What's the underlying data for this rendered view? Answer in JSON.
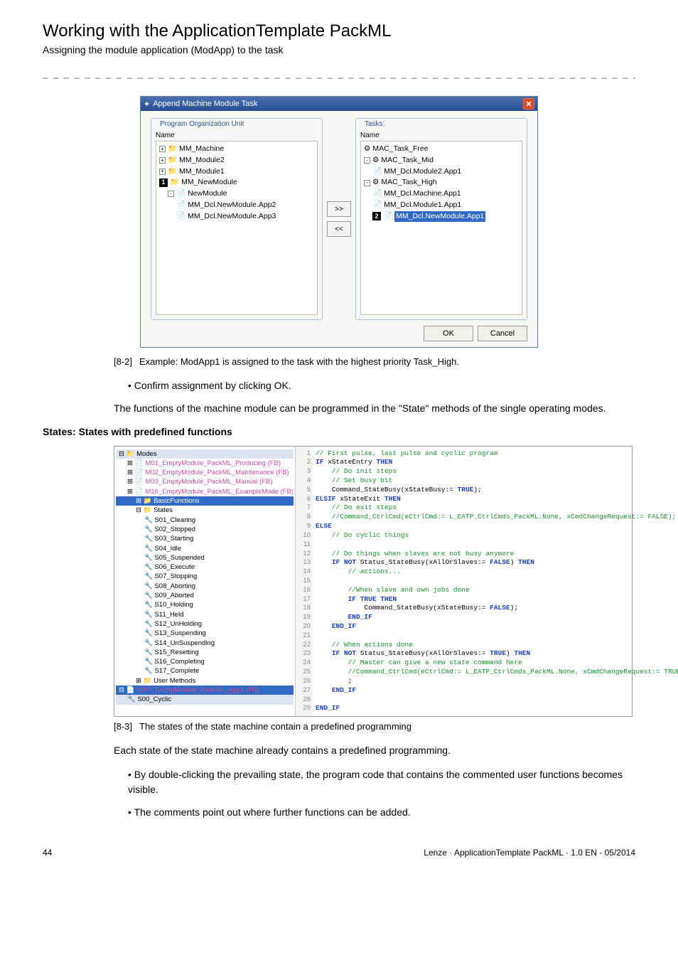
{
  "header": {
    "title": "Working with the ApplicationTemplate PackML",
    "subtitle": "Assigning the module application (ModApp) to the task"
  },
  "dialog": {
    "title": "Append Machine Module Task",
    "left_legend": "Program Organization Unit",
    "right_legend": "Tasks:",
    "name_label": "Name",
    "pou_tree": [
      {
        "lvl": 0,
        "icon": "folder",
        "exp": "+",
        "text": "MM_Machine"
      },
      {
        "lvl": 0,
        "icon": "folder",
        "exp": "+",
        "text": "MM_Module2"
      },
      {
        "lvl": 0,
        "icon": "folder",
        "exp": "+",
        "text": "MM_Module1"
      },
      {
        "lvl": 0,
        "icon": "folder",
        "num": "1",
        "text": "MM_NewModule"
      },
      {
        "lvl": 1,
        "icon": "doc",
        "exp": "-",
        "text": "NewModule"
      },
      {
        "lvl": 2,
        "icon": "doc",
        "text": "MM_Dcl.NewModule.App2"
      },
      {
        "lvl": 2,
        "icon": "doc",
        "text": "MM_Dcl.NewModule.App3"
      }
    ],
    "task_tree": [
      {
        "lvl": 0,
        "icon": "task",
        "text": "MAC_Task_Free"
      },
      {
        "lvl": 0,
        "icon": "task",
        "exp": "-",
        "text": "MAC_Task_Mid"
      },
      {
        "lvl": 1,
        "icon": "doc",
        "text": "MM_Dcl.Module2.App1"
      },
      {
        "lvl": 0,
        "icon": "task",
        "exp": "-",
        "text": "MAC_Task_High"
      },
      {
        "lvl": 1,
        "icon": "doc",
        "text": "MM_Dcl.Machine.App1"
      },
      {
        "lvl": 1,
        "icon": "doc",
        "text": "MM_Dcl.Module1.App1"
      },
      {
        "lvl": 1,
        "icon": "doc",
        "num": "2",
        "sel": true,
        "text": "MM_Dcl.NewModule.App1"
      }
    ],
    "btn_right": ">>",
    "btn_left": "<<",
    "ok": "OK",
    "cancel": "Cancel"
  },
  "fig82": {
    "ref": "[8-2]",
    "caption": "Example: ModApp1 is assigned to the task with the highest priority Task_High."
  },
  "confirm_bullet": "Confirm assignment by clicking OK.",
  "body_para": "The functions of the machine module can be programmed in the \"State\" methods of the single operating modes.",
  "states_heading": "States: States with predefined functions",
  "tree2": {
    "root": "Modes",
    "items": [
      "M01_EmptyModule_PackML_Producing (FB)",
      "M02_EmptyModule_PackML_Maintenance (FB)",
      "M03_EmptyModule_PackML_Manual (FB)",
      "M16_EmptyModule_PackML_ExampleMode (FB)"
    ],
    "basic": "BasicFunctions",
    "states_label": "States",
    "states": [
      "S01_Clearing",
      "S02_Stopped",
      "S03_Starting",
      "S04_Idle",
      "S05_Suspended",
      "S06_Execute",
      "S07_Stopping",
      "S08_Aborting",
      "S09_Aborted",
      "S10_Holding",
      "S11_Held",
      "S12_UnHolding",
      "S13_Suspending",
      "S14_UnSuspending",
      "S15_Resetting",
      "S16_Completing",
      "S17_Complete"
    ],
    "user_methods": "User Methods",
    "app": "MAP_EmptyModule_PackML_App1 (FB)",
    "cyclic": "S00_Cyclic"
  },
  "code": {
    "lines": [
      {
        "n": 1,
        "c": "cm",
        "t": "// First pulse, last pulse and cyclic program"
      },
      {
        "n": 2,
        "c": "",
        "t": "IF xStateEntry THEN",
        "kw": [
          "IF",
          "THEN"
        ]
      },
      {
        "n": 3,
        "c": "cm",
        "t": "    // Do init steps"
      },
      {
        "n": 4,
        "c": "cm",
        "t": "    // Set busy bit"
      },
      {
        "n": 5,
        "c": "",
        "t": "    Command_StateBusy(xStateBusy:= TRUE);",
        "kw": [
          "TRUE"
        ]
      },
      {
        "n": 6,
        "c": "",
        "t": "ELSIF xStateExit THEN",
        "kw": [
          "ELSIF",
          "THEN"
        ]
      },
      {
        "n": 7,
        "c": "cm",
        "t": "    // Do exit steps"
      },
      {
        "n": 8,
        "c": "cm",
        "t": "    //Command_CtrlCmd(eCtrlCmd:= L_EATP_CtrlCmds_PackML.None, xCmdChangeRequest:= FALSE);"
      },
      {
        "n": 9,
        "c": "",
        "t": "ELSE",
        "kw": [
          "ELSE"
        ]
      },
      {
        "n": 10,
        "c": "cm",
        "t": "    // Do cyclic things"
      },
      {
        "n": 11,
        "c": "",
        "t": ""
      },
      {
        "n": 12,
        "c": "cm",
        "t": "    // Do things when slaves are not busy anymore"
      },
      {
        "n": 13,
        "c": "",
        "t": "    IF NOT Status_StateBusy(xAllOrSlaves:= FALSE) THEN",
        "kw": [
          "IF",
          "NOT",
          "FALSE",
          "THEN"
        ]
      },
      {
        "n": 14,
        "c": "cm",
        "t": "        // actions..."
      },
      {
        "n": 15,
        "c": "",
        "t": ""
      },
      {
        "n": 16,
        "c": "cm",
        "t": "        //When slave and own jobs done"
      },
      {
        "n": 17,
        "c": "",
        "t": "        IF TRUE THEN",
        "kw": [
          "IF",
          "TRUE",
          "THEN"
        ]
      },
      {
        "n": 18,
        "c": "",
        "t": "            Command_StateBusy(xStateBusy:= FALSE);",
        "kw": [
          "FALSE"
        ]
      },
      {
        "n": 19,
        "c": "",
        "t": "        END_IF",
        "kw": [
          "END_IF"
        ]
      },
      {
        "n": 20,
        "c": "",
        "t": "    END_IF",
        "kw": [
          "END_IF"
        ]
      },
      {
        "n": 21,
        "c": "",
        "t": ""
      },
      {
        "n": 22,
        "c": "cm",
        "t": "    // When actions done"
      },
      {
        "n": 23,
        "c": "",
        "t": "    IF NOT Status_StateBusy(xAllOrSlaves:= TRUE) THEN",
        "kw": [
          "IF",
          "NOT",
          "TRUE",
          "THEN"
        ]
      },
      {
        "n": 24,
        "c": "cm",
        "t": "        // Master can give a new state command here"
      },
      {
        "n": 25,
        "c": "cm",
        "t": "        //Command_CtrlCmd(eCtrlCmd:= L_EATP_CtrlCmds_PackML.None, xCmdChangeRequest:= TRUE);"
      },
      {
        "n": 26,
        "c": "",
        "t": "        ;"
      },
      {
        "n": 27,
        "c": "",
        "t": "    END_IF",
        "kw": [
          "END_IF"
        ]
      },
      {
        "n": 28,
        "c": "",
        "t": ""
      },
      {
        "n": 29,
        "c": "",
        "t": "END_IF",
        "kw": [
          "END_IF"
        ]
      }
    ]
  },
  "fig83": {
    "ref": "[8-3]",
    "caption": "The states of the state machine contain a predefined programming"
  },
  "para2": "Each state of the state machine already contains a predefined programming.",
  "bullet2a": "By double-clicking the prevailing state, the program code that contains the commented user functions becomes visible.",
  "bullet2b": "The comments point out where further functions can be added.",
  "footer": {
    "page": "44",
    "info": "Lenze · ApplicationTemplate PackML · 1.0 EN - 05/2014"
  }
}
